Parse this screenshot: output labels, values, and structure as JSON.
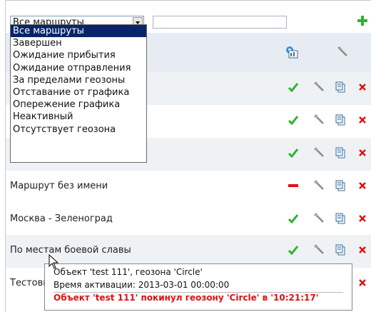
{
  "route_filter": {
    "selected": "Все маршруты",
    "options": [
      "Все маршруты",
      "Завершен",
      "Ожидание прибытия",
      "Ожидание отправления",
      "За пределами геозоны",
      "Отставание от графика",
      "Опережение графика",
      "Неактивный",
      "Отсутствует геозона"
    ]
  },
  "search": {
    "value": ""
  },
  "rows": [
    {
      "name": "",
      "status": "check"
    },
    {
      "name": "",
      "status": "check"
    },
    {
      "name": "",
      "status": "check"
    },
    {
      "name": "Маршрут без имени",
      "status": "dash"
    },
    {
      "name": "Москва - Зеленоград",
      "status": "check"
    },
    {
      "name": "По местам боевой славы",
      "status": "check"
    },
    {
      "name": "Тестовый",
      "status": "none"
    }
  ],
  "tooltip": {
    "line1": "Объект 'test 111', геозона 'Circle'",
    "line2": "Время активации: 2013-03-01 00:00:00",
    "line3": "Объект 'test 111' покинул геозону 'Circle' в '10:21:17'"
  },
  "colors": {
    "accent_green": "#2db32d",
    "delete_red": "#e01010",
    "selection_blue": "#0a246a",
    "row_alt": "#eef2f5"
  }
}
